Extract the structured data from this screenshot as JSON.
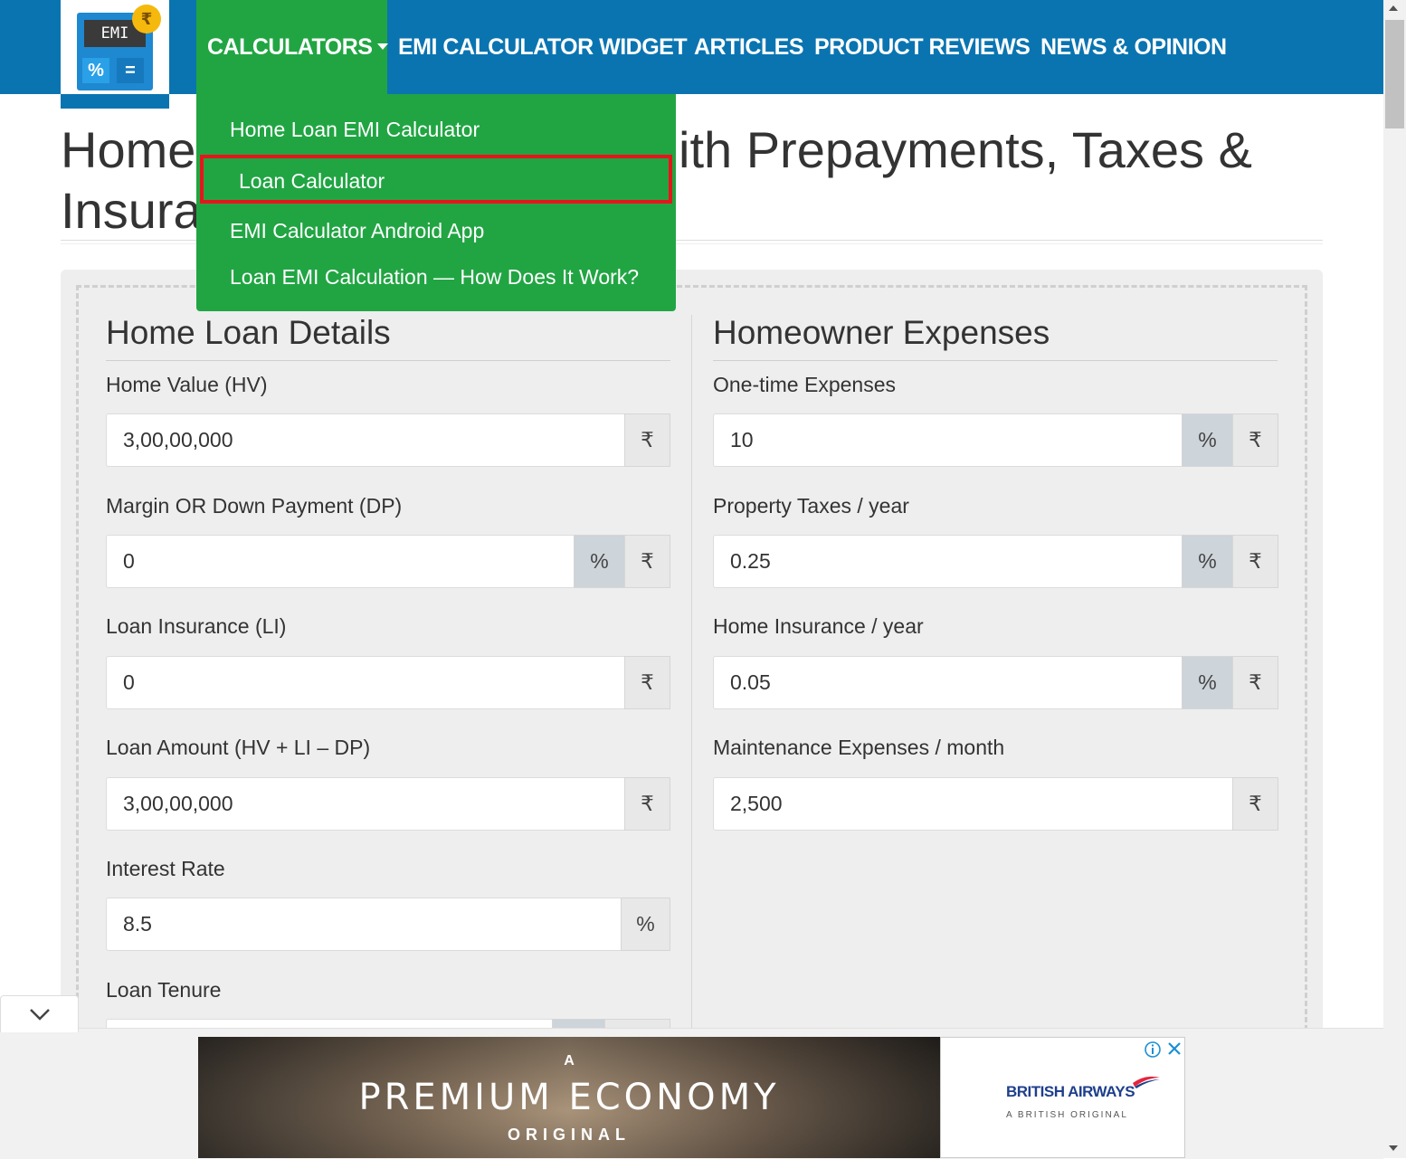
{
  "nav": {
    "logo": {
      "screen_text": "EMI",
      "coin": "₹",
      "key1": "%",
      "key2": "="
    },
    "items": [
      {
        "label": "CALCULATORS"
      },
      {
        "label": "EMI CALCULATOR WIDGET"
      },
      {
        "label": "ARTICLES"
      },
      {
        "label": "PRODUCT REVIEWS"
      },
      {
        "label": "NEWS & OPINION"
      }
    ],
    "dropdown": [
      {
        "label": "Home Loan EMI Calculator"
      },
      {
        "label": "Loan Calculator"
      },
      {
        "label": "EMI Calculator Android App"
      },
      {
        "label": "Loan EMI Calculation — How Does It Work?"
      }
    ]
  },
  "page": {
    "title_line1_start": "Home",
    "title_line1_end": "ith Prepayments, Taxes &",
    "title_line2": "Insura"
  },
  "left": {
    "title": "Home Loan Details",
    "fields": [
      {
        "label": "Home Value (HV)",
        "value": "3,00,00,000",
        "addons": [
          "₹"
        ]
      },
      {
        "label": "Margin OR Down Payment (DP)",
        "value": "0",
        "addons": [
          "%",
          "₹"
        ]
      },
      {
        "label": "Loan Insurance (LI)",
        "value": "0",
        "addons": [
          "₹"
        ]
      },
      {
        "label": "Loan Amount (HV + LI – DP)",
        "value": "3,00,00,000",
        "addons": [
          "₹"
        ]
      },
      {
        "label": "Interest Rate",
        "value": "8.5",
        "addons": [
          "%"
        ]
      },
      {
        "label": "Loan Tenure",
        "value": "",
        "addons": []
      }
    ]
  },
  "right": {
    "title": "Homeowner Expenses",
    "fields": [
      {
        "label": "One-time Expenses",
        "value": "10",
        "addons": [
          "%",
          "₹"
        ]
      },
      {
        "label": "Property Taxes / year",
        "value": "0.25",
        "addons": [
          "%",
          "₹"
        ]
      },
      {
        "label": "Home Insurance / year",
        "value": "0.05",
        "addons": [
          "%",
          "₹"
        ]
      },
      {
        "label": "Maintenance Expenses / month",
        "value": "2,500",
        "addons": [
          "₹"
        ]
      }
    ]
  },
  "ad": {
    "small": "A",
    "headline": "PREMIUM ECONOMY",
    "sub": "ORIGINAL",
    "brand": "BRITISH AIRWAYS",
    "tagline": "A BRITISH ORIGINAL"
  },
  "colors": {
    "header_bg": "#0a74b1",
    "nav_active": "#21a543",
    "highlight_border": "#e8141c"
  }
}
